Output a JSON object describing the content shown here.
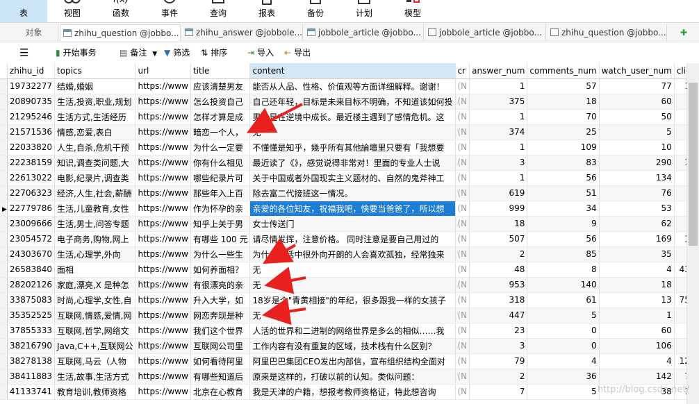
{
  "ribbon": {
    "items": [
      {
        "label": "表",
        "icon": "table-icon",
        "active": true
      },
      {
        "label": "视图",
        "icon": "view-icon"
      },
      {
        "label": "函数",
        "icon": "function-icon"
      },
      {
        "label": "事件",
        "icon": "event-icon"
      },
      {
        "label": "查询",
        "icon": "query-icon"
      },
      {
        "label": "报表",
        "icon": "report-icon"
      },
      {
        "label": "备份",
        "icon": "backup-icon"
      },
      {
        "label": "计划",
        "icon": "schedule-icon"
      },
      {
        "label": "模型",
        "icon": "model-icon"
      }
    ]
  },
  "tabs": {
    "items": [
      {
        "label": "对象"
      },
      {
        "label": "zhihu_question @jobbo...",
        "active": true
      },
      {
        "label": "zhihu_answer @jobbole..."
      },
      {
        "label": "jobbole_article @jobbo..."
      },
      {
        "label": "jobbole_article @jobbo..."
      },
      {
        "label": "zhihu_question @jobbo..."
      }
    ]
  },
  "toolbar": {
    "begin_transaction": "开始事务",
    "memo": "备注",
    "filter": "筛选",
    "sort": "排序",
    "import": "导入",
    "export": "导出"
  },
  "grid": {
    "columns": [
      "zhihu_id",
      "topics",
      "url",
      "title",
      "content",
      "cr",
      "answer_num",
      "comments_num",
      "watch_user_num",
      "click",
      "cra"
    ],
    "rows": [
      [
        "19732277",
        "结婚,婚姻",
        "https://www",
        "应该清楚男友",
        "能否从人品、性格、价值观等方面详细解释。谢谢！",
        "(N",
        "1",
        "57",
        "77",
        "11",
        "20"
      ],
      [
        "20890735",
        "生活,投资,职业,规划",
        "https://www",
        "怎么投资自己",
        "自己还年轻，目标是未来目标不明确，不知道该如何投",
        "(N",
        "375",
        "18",
        "60",
        "4",
        "20"
      ],
      [
        "21295246",
        "生活方式,生活经历",
        "https://www",
        "怎样才算是成",
        "男人是在逆境中成长。最近楼主遇到了感情危机。这",
        "(N",
        "1",
        "70",
        "50",
        "5",
        "20"
      ],
      [
        "21571536",
        "情感,恋爱,表白",
        "https://www",
        "暗恋一个人，",
        "无",
        "(N",
        "374",
        "25",
        "5",
        "1",
        "20"
      ],
      [
        "22033820",
        "人生,自杀,危机干预",
        "https://www",
        "为什么一定要",
        "不懂懂是知乎，幾乎所有其他論壇里只要有「我想要",
        "(N",
        "1",
        "109",
        "10",
        "2",
        "20"
      ],
      [
        "22238159",
        "知识,调查类问题,大",
        "https://www",
        "你有什么相见",
        "最近读了《》，感觉说得非常对！里面的专业人士说",
        "(N",
        "3",
        "83",
        "290",
        "18",
        "20"
      ],
      [
        "22613022",
        "电影,纪录片,调查类",
        "https://www",
        "哪些纪录片可",
        "关于中国或者外国现实主义题材的、自然的鬼斧神工",
        "(N",
        "1",
        "56",
        "134",
        "4",
        "20"
      ],
      [
        "22706323",
        "经济,人生,社会,薪酬",
        "https://www",
        "那些年入上百",
        "除去富二代接班这一情况。",
        "(N",
        "619",
        "51",
        "76",
        "5",
        "20"
      ],
      [
        "22779786",
        "生活,儿童教育,女性",
        "https://www",
        "作为怀孕的亲",
        "亲爱的各位知友，祝福我吧，快要当爸爸了，所以想",
        "(N",
        "999",
        "34",
        "53",
        "7",
        "20"
      ],
      [
        "23009666",
        "生活,男士,问答专题",
        "https://www",
        "知乎上关于男",
        "女士传送门",
        "(N",
        "18",
        "9",
        "62",
        "1",
        "20"
      ],
      [
        "23054572",
        "电子商务,购物,网上",
        "https://www",
        "有哪些 100 元",
        "请尽情发挥，注意价格。 同时注意是要自己用过的",
        "(N",
        "507",
        "56",
        "169",
        "15",
        "20"
      ],
      [
        "24303670",
        "生活,心理学,外向",
        "https://www",
        "为什么一些生",
        "为什么生活中很外向开朗的人会喜欢孤独，经常独来",
        "(N",
        "2",
        "85",
        "35",
        "2",
        "20"
      ],
      [
        "26583840",
        "面相",
        "https://www",
        "如何养面相？",
        "无",
        "(N",
        "48",
        "8",
        "4",
        "433",
        "20"
      ],
      [
        "28202126",
        "家庭,漂亮,X 是种怎",
        "https://www",
        "有很漂亮的亲",
        "无",
        "(N",
        "953",
        "140",
        "18",
        "6",
        "20"
      ],
      [
        "33875083",
        "时尚,心理学,女性,自",
        "https://www",
        "升入大学，如",
        "18岁是个\"青黄相接\"的年纪，很多跟我一样的女孩子",
        "(N",
        "318",
        "61",
        "13",
        "753",
        "20"
      ],
      [
        "35352525",
        "互联网,情感,爱情,网",
        "https://www",
        "网恋奔现是种",
        "无",
        "(N",
        "447",
        "5",
        "1",
        "1",
        "20"
      ],
      [
        "37855333",
        "互联网,哲学,网络文",
        "https://www",
        "我们这个世界",
        "人活的世界和二进制的网络世界是多么的相似……我",
        "(N",
        "23",
        "0",
        "60",
        "6",
        "20"
      ],
      [
        "38216790",
        "Java,C++,互联网公",
        "https://www",
        "互联网公司里",
        "工作内容有没有重复的区域，技术栈有什么区别？",
        "(N",
        "3",
        "0",
        "106",
        "4",
        "20"
      ],
      [
        "38278138",
        "互联网,马云（人物",
        "https://www",
        "如何看待阿里",
        "阿里巴巴集团CEO发出内部信，宣布组织结构全面对",
        "(N",
        "79",
        "4",
        "4",
        "126",
        "20"
      ],
      [
        "38411883",
        "生活,故事,生活方式",
        "https://www",
        "有哪些知道后",
        "原来是这样的，打破以前的认知。类似问题：",
        "(N",
        "2",
        "36",
        "142",
        "74",
        "20"
      ],
      [
        "41133741",
        "教育培训,教师资格",
        "https://www",
        "北京在心教育",
        "我是天津的户籍，想报考教师资格证，特此想咨询",
        "(N",
        "7",
        "5",
        "38",
        "17",
        "20"
      ]
    ],
    "selected_row": 8
  },
  "watermark": "http://blog.csdn.net/"
}
